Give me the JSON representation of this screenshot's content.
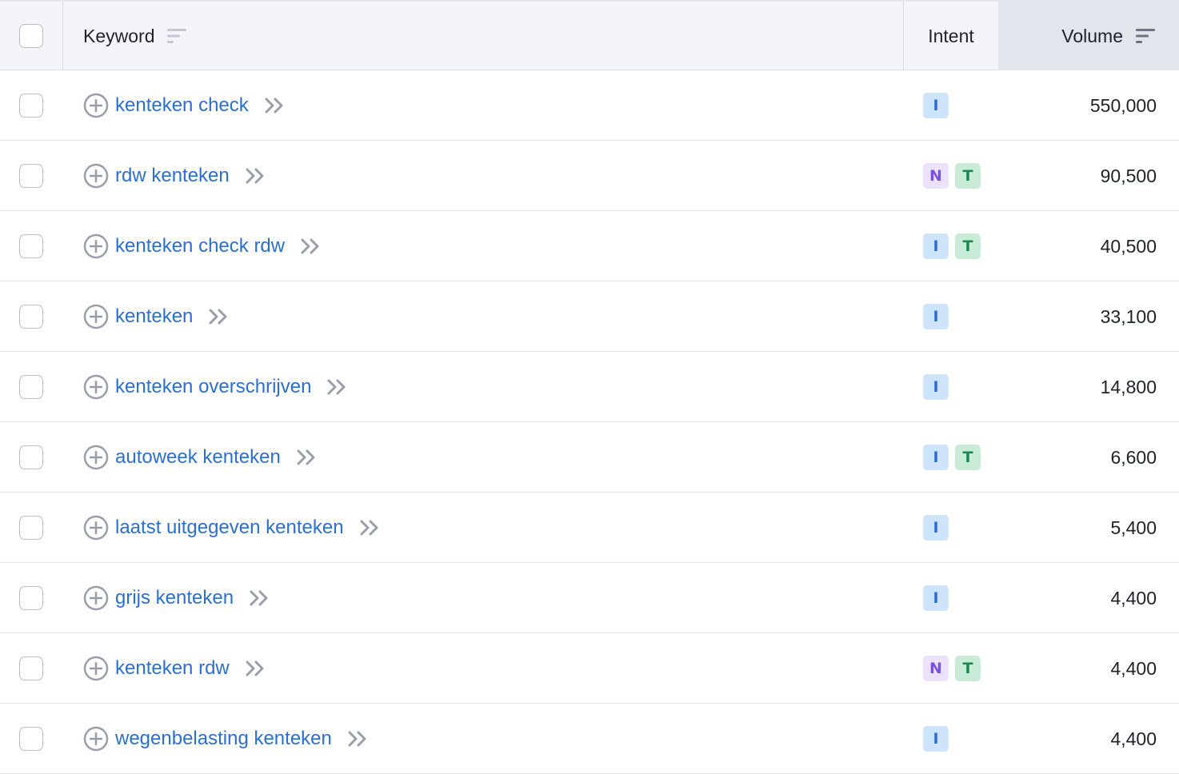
{
  "header": {
    "keyword": "Keyword",
    "intent": "Intent",
    "volume": "Volume"
  },
  "rows": [
    {
      "keyword": "kenteken check",
      "intents": [
        "I"
      ],
      "volume": "550,000"
    },
    {
      "keyword": "rdw kenteken",
      "intents": [
        "N",
        "T"
      ],
      "volume": "90,500"
    },
    {
      "keyword": "kenteken check rdw",
      "intents": [
        "I",
        "T"
      ],
      "volume": "40,500"
    },
    {
      "keyword": "kenteken",
      "intents": [
        "I"
      ],
      "volume": "33,100"
    },
    {
      "keyword": "kenteken overschrijven",
      "intents": [
        "I"
      ],
      "volume": "14,800"
    },
    {
      "keyword": "autoweek kenteken",
      "intents": [
        "I",
        "T"
      ],
      "volume": "6,600"
    },
    {
      "keyword": "laatst uitgegeven kenteken",
      "intents": [
        "I"
      ],
      "volume": "5,400"
    },
    {
      "keyword": "grijs kenteken",
      "intents": [
        "I"
      ],
      "volume": "4,400"
    },
    {
      "keyword": "kenteken rdw",
      "intents": [
        "N",
        "T"
      ],
      "volume": "4,400"
    },
    {
      "keyword": "wegenbelasting kenteken",
      "intents": [
        "I"
      ],
      "volume": "4,400"
    }
  ],
  "icons": {
    "row_add": "plus-circle-icon",
    "row_expand": "double-chevron-right-icon",
    "sort": "sort-lines-icon"
  },
  "colors": {
    "link": "#2b6fd1",
    "intent_I_bg": "#cde4fb",
    "intent_N_bg": "#ece2fb",
    "intent_T_bg": "#c9ecd8"
  }
}
